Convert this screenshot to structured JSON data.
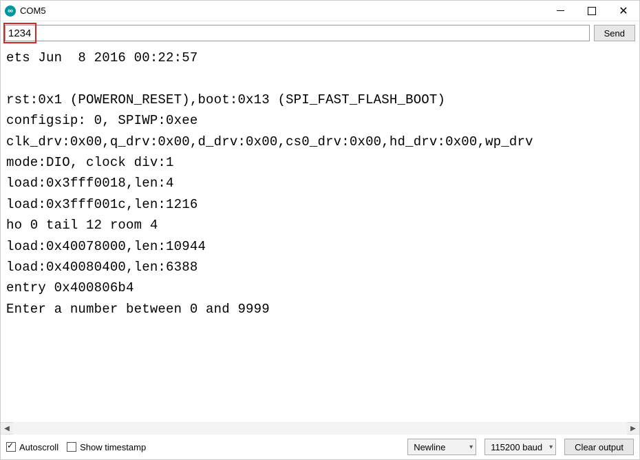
{
  "window": {
    "title": "COM5"
  },
  "input": {
    "value": "1234",
    "send_label": "Send"
  },
  "serial_output": "ets Jun  8 2016 00:22:57\n\nrst:0x1 (POWERON_RESET),boot:0x13 (SPI_FAST_FLASH_BOOT)\nconfigsip: 0, SPIWP:0xee\nclk_drv:0x00,q_drv:0x00,d_drv:0x00,cs0_drv:0x00,hd_drv:0x00,wp_drv\nmode:DIO, clock div:1\nload:0x3fff0018,len:4\nload:0x3fff001c,len:1216\nho 0 tail 12 room 4\nload:0x40078000,len:10944\nload:0x40080400,len:6388\nentry 0x400806b4\nEnter a number between 0 and 9999",
  "footer": {
    "autoscroll_label": "Autoscroll",
    "autoscroll_checked": true,
    "timestamp_label": "Show timestamp",
    "timestamp_checked": false,
    "line_ending": "Newline",
    "baud_rate": "115200 baud",
    "clear_label": "Clear output"
  }
}
